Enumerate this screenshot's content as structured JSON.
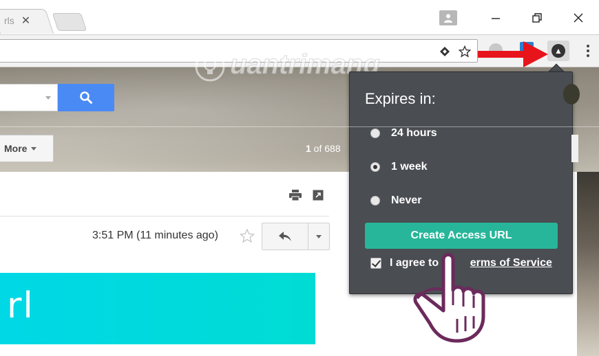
{
  "browser": {
    "tab_title": "rls",
    "tab_close": "✕"
  },
  "gmail": {
    "more_label": "More",
    "pager_current": "1",
    "pager_rest": " of 688",
    "timestamp": "3:51 PM (11 minutes ago)",
    "banner_text": "rl"
  },
  "popup": {
    "title": "Expires in:",
    "options": [
      {
        "label": "24 hours",
        "checked": false
      },
      {
        "label": "1 week",
        "checked": true
      },
      {
        "label": "Never",
        "checked": false
      }
    ],
    "create_button": "Create Access URL",
    "agree_prefix": "I agree to th",
    "agree_link": "erms of Service"
  },
  "watermark": {
    "text": "uantrimang"
  },
  "colors": {
    "accent_green": "#27b699",
    "search_blue": "#4a8af4",
    "popup_bg": "#4a4d52",
    "arrow_red": "#e8141c",
    "banner_cyan": "#00d8e6"
  },
  "icons": [
    "person-icon",
    "minimize-icon",
    "restore-icon",
    "close-icon",
    "extension-diamond-icon",
    "bookmark-star-icon",
    "ext-a-icon",
    "menu-dots-icon",
    "search-icon",
    "print-icon",
    "popout-icon",
    "star-icon",
    "reply-icon",
    "hand-cursor-icon",
    "red-arrow-icon"
  ]
}
